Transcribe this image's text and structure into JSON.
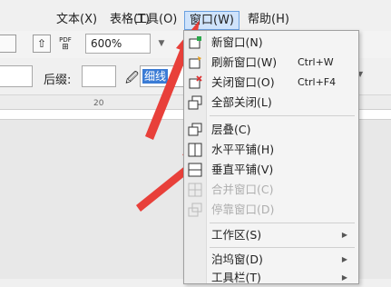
{
  "menubar": {
    "items": [
      {
        "label": "文本(X)"
      },
      {
        "label": "表格(T)"
      },
      {
        "label": "工具(O)"
      },
      {
        "label": "窗口(W)"
      },
      {
        "label": "帮助(H)"
      }
    ]
  },
  "toolbar": {
    "zoom_value": "600%",
    "pdf_label": "PDF",
    "suffix_label": "后缀:",
    "selected_text": "细线"
  },
  "ruler": {
    "tick_label": "20"
  },
  "window_menu": {
    "items": [
      {
        "label": "新窗口(N)",
        "shortcut": "",
        "icon": "new-window-icon",
        "enabled": true
      },
      {
        "label": "刷新窗口(W)",
        "shortcut": "Ctrl+W",
        "icon": "refresh-window-icon",
        "enabled": true
      },
      {
        "label": "关闭窗口(O)",
        "shortcut": "Ctrl+F4",
        "icon": "close-window-icon",
        "enabled": true
      },
      {
        "label": "全部关闭(L)",
        "shortcut": "",
        "icon": "close-all-icon",
        "enabled": true
      },
      {
        "label": "层叠(C)",
        "shortcut": "",
        "icon": "cascade-icon",
        "enabled": true
      },
      {
        "label": "水平平铺(H)",
        "shortcut": "",
        "icon": "tile-horizontal-icon",
        "enabled": true
      },
      {
        "label": "垂直平铺(V)",
        "shortcut": "",
        "icon": "tile-vertical-icon",
        "enabled": true
      },
      {
        "label": "合并窗口(C)",
        "shortcut": "",
        "icon": "merge-window-icon",
        "enabled": false
      },
      {
        "label": "停靠窗口(D)",
        "shortcut": "",
        "icon": "dock-window-icon",
        "enabled": false
      },
      {
        "label": "工作区(S)",
        "shortcut": "",
        "submenu": true
      },
      {
        "label": "泊坞窗(D)",
        "shortcut": "",
        "submenu": true
      },
      {
        "label": "工具栏(T)",
        "shortcut": "",
        "submenu": true
      }
    ]
  },
  "colors": {
    "arrow": "#e8403a",
    "menu_highlight": "#cfe3fb",
    "selected_text_bg": "#3a7bd5"
  }
}
